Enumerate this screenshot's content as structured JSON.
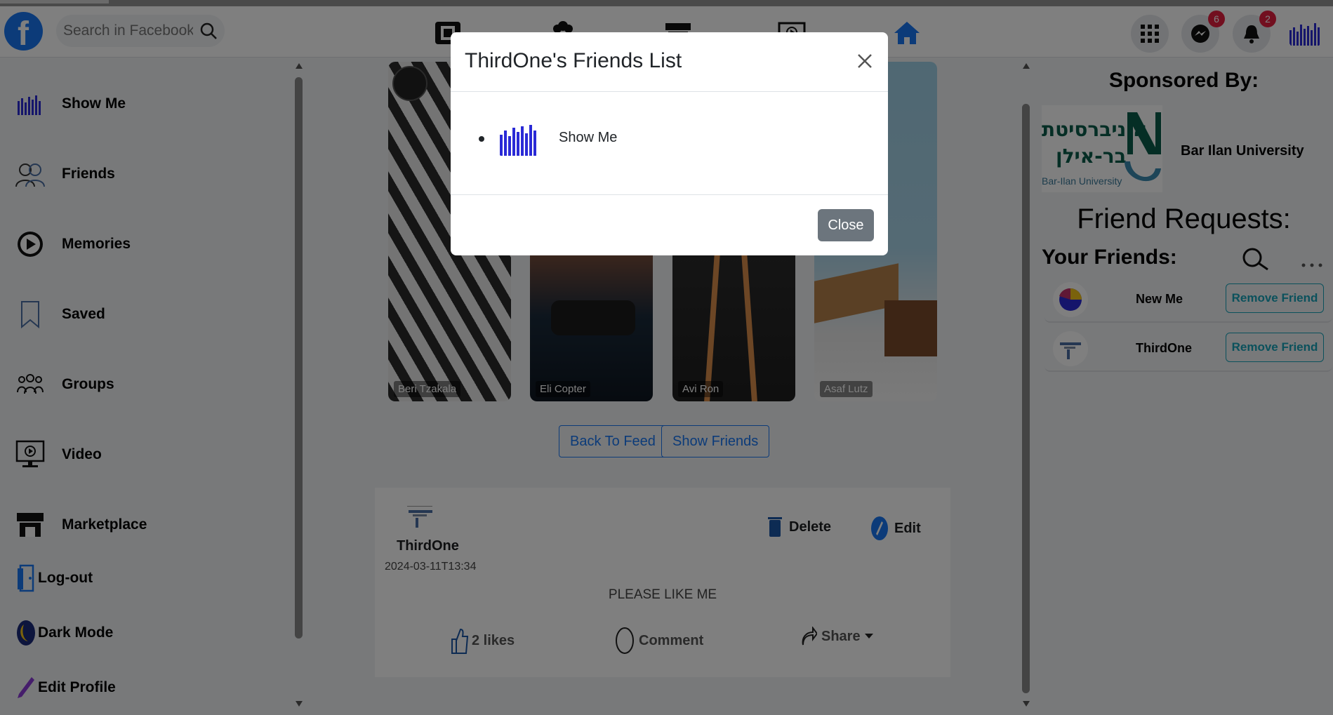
{
  "search": {
    "placeholder": "Search in Facebook"
  },
  "notifications": {
    "messenger_count": "6",
    "bell_count": "2"
  },
  "sidebar": {
    "items": [
      {
        "label": "Show Me"
      },
      {
        "label": "Friends"
      },
      {
        "label": "Memories"
      },
      {
        "label": "Saved"
      },
      {
        "label": "Groups"
      },
      {
        "label": "Video"
      },
      {
        "label": "Marketplace"
      },
      {
        "label": "Log-out"
      },
      {
        "label": "Dark Mode"
      },
      {
        "label": "Edit Profile"
      }
    ]
  },
  "stories": [
    {
      "name": "Beri Tzakala"
    },
    {
      "name": "Eli Copter"
    },
    {
      "name": "Avi Ron"
    },
    {
      "name": "Asaf Lutz"
    }
  ],
  "profile_buttons": {
    "back": "Back To Feed",
    "show_friends": "Show Friends"
  },
  "post": {
    "author": "ThirdOne",
    "date": "2024-03-11T13:34",
    "text": "PLEASE LIKE ME",
    "delete_label": "Delete",
    "edit_label": "Edit",
    "likes_label": "2 likes",
    "comment_label": "Comment",
    "share_label": "Share"
  },
  "right": {
    "sponsored_title": "Sponsored By:",
    "sponsor_name": "Bar Ilan University",
    "sponsor_logo_hebrew_1": "אוניברסיטת",
    "sponsor_logo_hebrew_2": "בר-אילן",
    "sponsor_logo_english": "Bar-Ilan University",
    "friend_requests_title": "Friend Requests:",
    "your_friends_title": "Your Friends:",
    "friends": [
      {
        "name": "New Me",
        "button": "Remove Friend"
      },
      {
        "name": "ThirdOne",
        "button": "Remove Friend"
      }
    ]
  },
  "modal": {
    "title": "ThirdOne's Friends List",
    "friends": [
      {
        "name": "Show Me"
      }
    ],
    "close_label": "Close"
  },
  "colors": {
    "brand": "#1877f2",
    "badge": "#e41e3f",
    "remove_button": "#17a2b8",
    "close_button": "#6c757d"
  }
}
